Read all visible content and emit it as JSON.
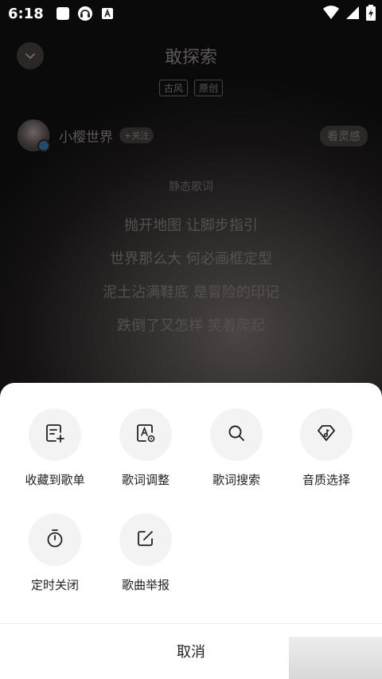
{
  "status_bar": {
    "time": "6:18"
  },
  "player": {
    "song_title": "敢探索",
    "tags": [
      "古风",
      "原创"
    ],
    "artist_name": "小樱世界",
    "follow_label": "+关注",
    "inspire_label": "看灵感",
    "static_lyrics_label": "静态歌词",
    "lyrics": [
      "抛开地图 让脚步指引",
      "世界那么大 何必画框定型",
      "泥土沾满鞋底 是冒险的印记",
      "跌倒了又怎样 笑着爬起"
    ]
  },
  "sheet": {
    "actions": [
      {
        "label": "收藏到歌单",
        "icon": "add-to-playlist-icon"
      },
      {
        "label": "歌词调整",
        "icon": "lyrics-adjust-icon"
      },
      {
        "label": "歌词搜索",
        "icon": "search-icon"
      },
      {
        "label": "音质选择",
        "icon": "sound-quality-icon"
      },
      {
        "label": "定时关闭",
        "icon": "timer-icon"
      },
      {
        "label": "歌曲举报",
        "icon": "report-icon"
      }
    ],
    "cancel_label": "取消"
  }
}
